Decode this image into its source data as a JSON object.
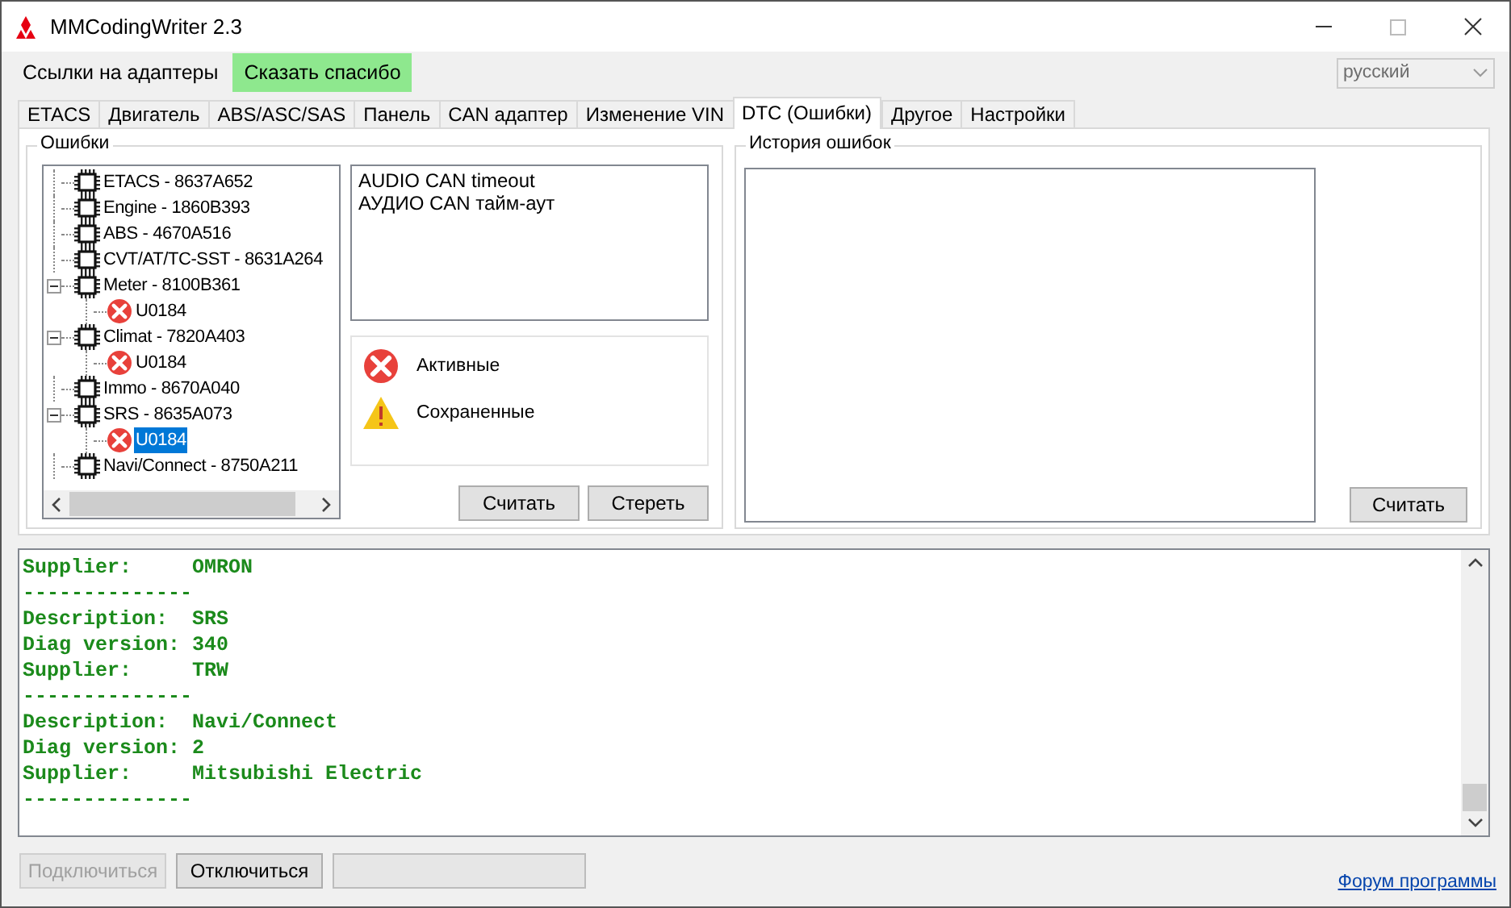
{
  "window": {
    "title": "MMCodingWriter 2.3"
  },
  "menu": [
    {
      "label": "Ссылки на адаптеры",
      "kind": "plain"
    },
    {
      "label": "Сказать спасибо",
      "kind": "highlight"
    }
  ],
  "language": {
    "value": "русский",
    "disabled": true
  },
  "tabs": [
    {
      "label": "ETACS",
      "selected": false
    },
    {
      "label": "Двигатель",
      "selected": false
    },
    {
      "label": "ABS/ASC/SAS",
      "selected": false
    },
    {
      "label": "Панель",
      "selected": false
    },
    {
      "label": "CAN адаптер",
      "selected": false
    },
    {
      "label": "Изменение VIN",
      "selected": false
    },
    {
      "label": "DTC (Ошибки)",
      "selected": true
    },
    {
      "label": "Другое",
      "selected": false
    },
    {
      "label": "Настройки",
      "selected": false
    }
  ],
  "errors_group": {
    "title": "Ошибки",
    "tree": [
      {
        "label": "ETACS - 8637A652",
        "kind": "module",
        "selected": false
      },
      {
        "label": "Engine - 1860B393",
        "kind": "module",
        "selected": false
      },
      {
        "label": "ABS - 4670A516",
        "kind": "module",
        "selected": false
      },
      {
        "label": "CVT/AT/TC-SST - 8631A264",
        "kind": "module",
        "selected": false
      },
      {
        "label": "Meter - 8100B361",
        "kind": "module",
        "selected": false,
        "expanded": true,
        "children": [
          {
            "label": "U0184",
            "kind": "active",
            "selected": false
          }
        ]
      },
      {
        "label": "Climat - 7820A403",
        "kind": "module",
        "selected": false,
        "expanded": true,
        "children": [
          {
            "label": "U0184",
            "kind": "active",
            "selected": false
          }
        ]
      },
      {
        "label": "Immo - 8670A040",
        "kind": "module",
        "selected": false
      },
      {
        "label": "SRS - 8635A073",
        "kind": "module",
        "selected": false,
        "expanded": true,
        "children": [
          {
            "label": "U0184",
            "kind": "active",
            "selected": true
          }
        ]
      },
      {
        "label": "Navi/Connect - 8750A211",
        "kind": "module",
        "selected": false
      }
    ],
    "description": [
      "AUDIO CAN timeout",
      "АУДИО CAN тайм-аут"
    ],
    "legend": [
      {
        "label": "Активные",
        "kind": "active"
      },
      {
        "label": "Сохраненные",
        "kind": "stored"
      }
    ],
    "buttons": [
      "Считать",
      "Стереть"
    ]
  },
  "history_group": {
    "title": "История ошибок",
    "buttons": [
      "Считать"
    ]
  },
  "log": [
    "Supplier:     OMRON",
    "--------------",
    "Description:  SRS",
    "Diag version: 340",
    "Supplier:     TRW",
    "--------------",
    "Description:  Navi/Connect",
    "Diag version: 2",
    "Supplier:     Mitsubishi Electric",
    "--------------"
  ],
  "bottom": {
    "buttons": [
      {
        "label": "Подключиться",
        "disabled": true
      },
      {
        "label": "Отключиться",
        "disabled": false
      }
    ],
    "link": "Форум программы"
  }
}
